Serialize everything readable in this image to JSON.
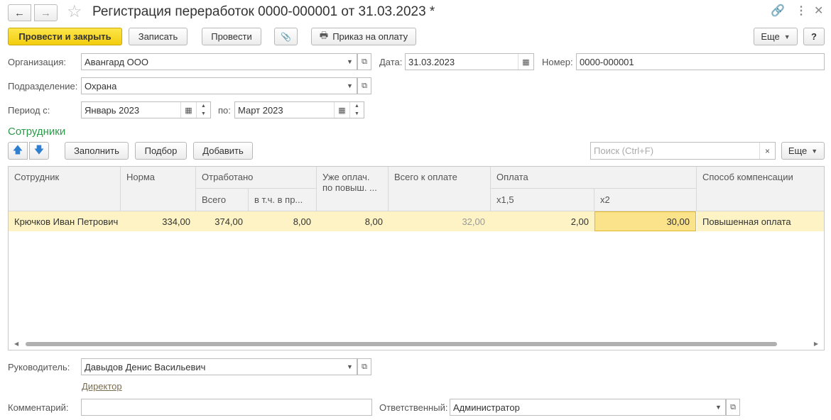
{
  "window": {
    "title": "Регистрация переработок 0000-000001 от 31.03.2023 *",
    "back_icon": "←",
    "forward_icon": "→",
    "star_icon": "☆",
    "link_icon": "🔗",
    "more_icon": "⋮",
    "close_icon": "✕"
  },
  "toolbar": {
    "post_and_close": "Провести и закрыть",
    "save": "Записать",
    "post": "Провести",
    "attach_icon": "📎",
    "print_icon": "🖶",
    "payment_order": "Приказ на оплату",
    "more": "Еще",
    "help": "?"
  },
  "form": {
    "organization_label": "Организация:",
    "organization_value": "Авангард ООО",
    "date_label": "Дата:",
    "date_value": "31.03.2023",
    "number_label": "Номер:",
    "number_value": "0000-000001",
    "department_label": "Подразделение:",
    "department_value": "Охрана",
    "period_label": "Период с:",
    "period_from": "Январь 2023",
    "period_to_label": "по:",
    "period_to": "Март 2023"
  },
  "employees": {
    "section_title": "Сотрудники",
    "up_icon": "🡅",
    "down_icon": "🡇",
    "fill": "Заполнить",
    "pick": "Подбор",
    "add": "Добавить",
    "search_placeholder": "Поиск (Ctrl+F)",
    "clear_icon": "×",
    "more": "Еще"
  },
  "table": {
    "headers": {
      "employee": "Сотрудник",
      "norm": "Норма",
      "worked": "Отработано",
      "worked_total": "Всего",
      "worked_incl": "в т.ч. в пр...",
      "already_paid": "Уже оплач. по повыш. ...",
      "total_to_pay": "Всего к оплате",
      "payment": "Оплата",
      "pay_x15": "x1,5",
      "pay_x2": "x2",
      "compensation": "Способ компенсации"
    },
    "rows": [
      {
        "employee": "Крючков Иван Петрович",
        "norm": "334,00",
        "worked_total": "374,00",
        "worked_incl": "8,00",
        "already_paid": "8,00",
        "total_to_pay": "32,00",
        "pay_x15": "2,00",
        "pay_x2": "30,00",
        "compensation": "Повышенная оплата"
      }
    ]
  },
  "footer": {
    "manager_label": "Руководитель:",
    "manager_value": "Давыдов Денис Васильевич",
    "manager_position": "Директор",
    "comment_label": "Комментарий:",
    "comment_value": "",
    "responsible_label": "Ответственный:",
    "responsible_value": "Администратор"
  }
}
